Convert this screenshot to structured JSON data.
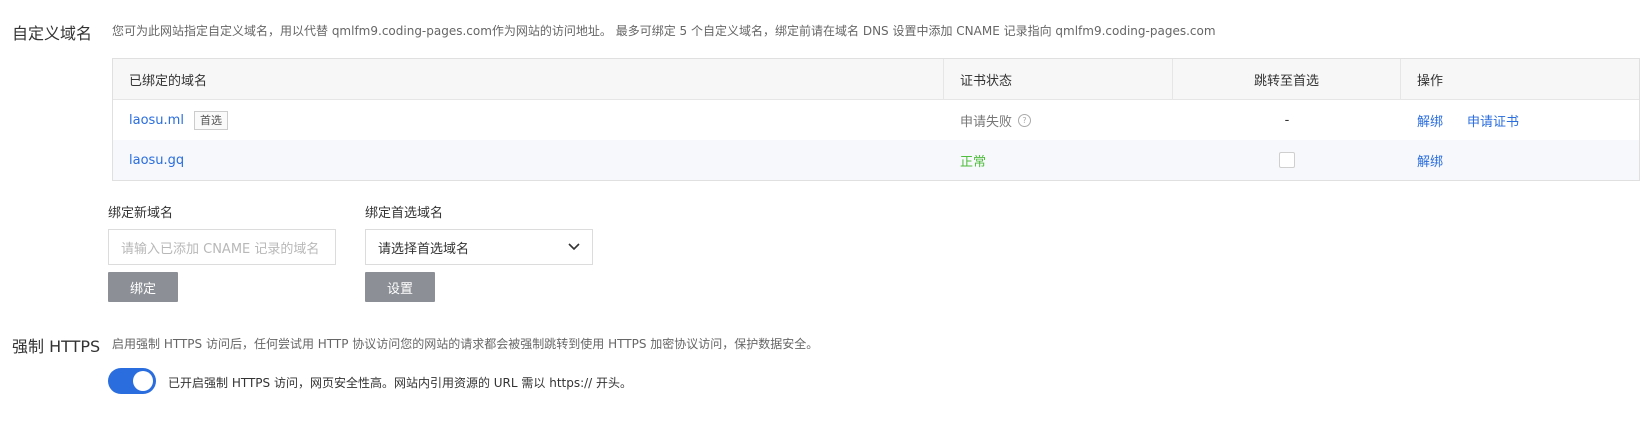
{
  "domain_section": {
    "title": "自定义域名",
    "description": "您可为此网站指定自定义域名，用以代替 qmlfm9.coding-pages.com作为网站的访问地址。 最多可绑定 5 个自定义域名，绑定前请在域名 DNS 设置中添加 CNAME 记录指向 qmlfm9.coding-pages.com"
  },
  "table": {
    "headers": [
      "已绑定的域名",
      "证书状态",
      "跳转至首选",
      "操作"
    ],
    "rows": [
      {
        "domain": "laosu.ml",
        "tag": "首选",
        "cert_status": "申请失败",
        "redirect": "-",
        "actions": [
          "解绑",
          "申请证书"
        ]
      },
      {
        "domain": "laosu.gq",
        "cert_status": "正常",
        "redirect_checked": false,
        "actions": [
          "解绑"
        ]
      }
    ]
  },
  "bind_form": {
    "label": "绑定新域名",
    "placeholder": "请输入已添加 CNAME 记录的域名",
    "button": "绑定"
  },
  "preferred_form": {
    "label": "绑定首选域名",
    "select_value": "请选择首选域名",
    "button": "设置"
  },
  "https_section": {
    "title": "强制 HTTPS",
    "description": "启用强制 HTTPS 访问后，任何尝试用 HTTP 协议访问您的网站的请求都会被强制跳转到使用 HTTPS 加密协议访问，保护数据安全。",
    "toggle_on": true,
    "toggle_text": "已开启强制 HTTPS 访问，网页安全性高。网站内引用资源的 URL 需以 https:// 开头。"
  },
  "colors": {
    "accent": "#2a6dde",
    "success": "#4fbd3d",
    "button_gray": "#8c9096"
  }
}
